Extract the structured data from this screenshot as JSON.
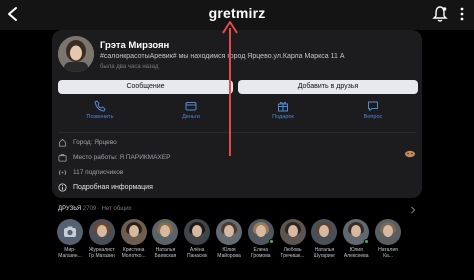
{
  "header": {
    "username": "gretmirz"
  },
  "profile": {
    "name": "Грэта Мирзоян",
    "status": "#салонкрасотыАревик# мы находимся город Ярцево.ул.Карла Маркса 11 А",
    "last_seen": "была два часа назад"
  },
  "buttons": {
    "message": "Сообщение",
    "add_friend": "Добавить в друзья"
  },
  "actions": [
    {
      "label": "Позвонить",
      "icon": "phone-icon"
    },
    {
      "label": "Деньги",
      "icon": "money-icon"
    },
    {
      "label": "Подарок",
      "icon": "gift-icon"
    },
    {
      "label": "Вопрос",
      "icon": "question-icon"
    }
  ],
  "info": {
    "city": "Город: Ярцево",
    "work": "Место работы: Я ПАРИКМАХЕР",
    "followers": "117 подписчиков",
    "details": "Подробная информация"
  },
  "friends": {
    "title": "ДРУЗЬЯ",
    "count": "2709 · Нет общих",
    "list": [
      {
        "first": "Мир-",
        "last": "Магазин..."
      },
      {
        "first": "Журналист",
        "last": "Гр Магазин"
      },
      {
        "first": "Кристина",
        "last": "Молотко..."
      },
      {
        "first": "Наталья",
        "last": "Баевская"
      },
      {
        "first": "Алёна",
        "last": "Панасюк"
      },
      {
        "first": "Юлия",
        "last": "Майорова"
      },
      {
        "first": "Елена",
        "last": "Громова"
      },
      {
        "first": "Любовь",
        "last": "Гречишк..."
      },
      {
        "first": "Наталья",
        "last": "Шугаринг"
      },
      {
        "first": "Юлия",
        "last": "Алексеева"
      },
      {
        "first": "Наталия",
        "last": "Ка..."
      }
    ]
  },
  "colors": {
    "accent": "#4f8ad6",
    "card": "#1c1c1e",
    "arrow": "#e34b4b",
    "online": "#4bb34b"
  }
}
